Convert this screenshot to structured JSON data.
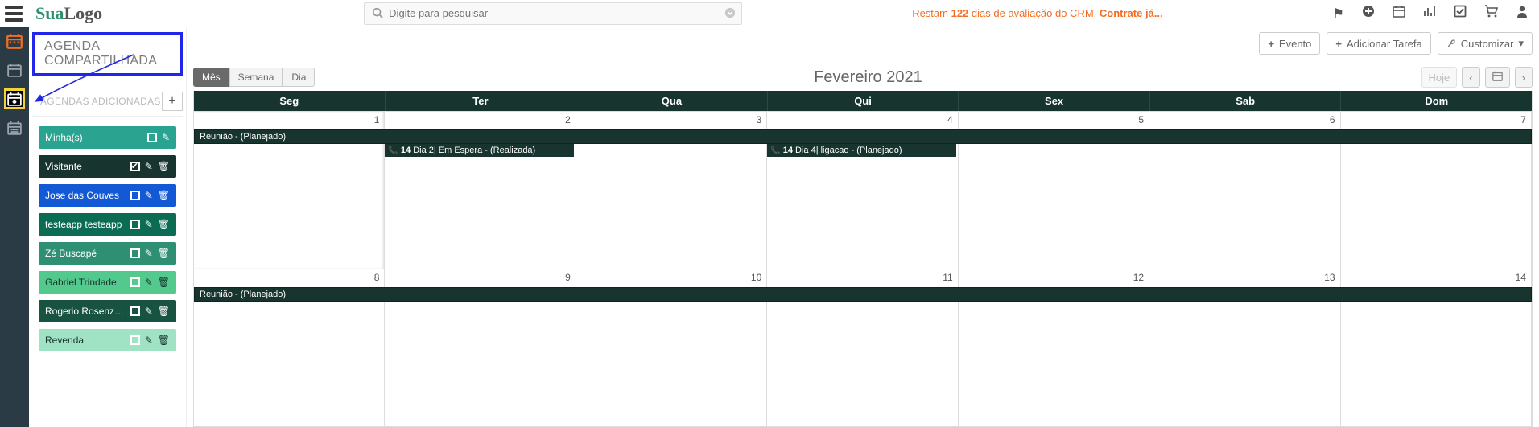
{
  "header": {
    "logo_part1": "Sua",
    "logo_part2": "Logo",
    "search_placeholder": "Digite para pesquisar",
    "trial_prefix": "Restam ",
    "trial_days": "122",
    "trial_mid": " dias de avaliação do CRM. ",
    "trial_link": "Contrate já..."
  },
  "sidebar": {
    "tab_title": "AGENDA COMPARTILHADA",
    "section_label": "AGENDAS ADICIONADAS",
    "items": [
      {
        "label": "Minha(s)",
        "color": "#2aa491",
        "checked": false,
        "can_delete": false
      },
      {
        "label": "Visitante",
        "color": "#17342e",
        "checked": true,
        "can_delete": true
      },
      {
        "label": "Jose das Couves",
        "color": "#1359d6",
        "checked": false,
        "can_delete": true
      },
      {
        "label": "testeapp testeapp",
        "color": "#0c6b53",
        "checked": false,
        "can_delete": true
      },
      {
        "label": "Zé Buscapé",
        "color": "#2f8f73",
        "checked": false,
        "can_delete": true
      },
      {
        "label": "Gabriel Trindade",
        "color": "#53c98d",
        "checked": false,
        "can_delete": true
      },
      {
        "label": "Rogerio Rosenzveig",
        "color": "#175340",
        "checked": false,
        "can_delete": true
      },
      {
        "label": "Revenda",
        "color": "#9fe2c4",
        "checked": false,
        "can_delete": true
      }
    ]
  },
  "toolbar": {
    "evento": "Evento",
    "add_tarefa": "Adicionar Tarefa",
    "customizar": "Customizar"
  },
  "calendar": {
    "views": {
      "month": "Mês",
      "week": "Semana",
      "day": "Dia"
    },
    "title": "Fevereiro 2021",
    "today": "Hoje",
    "dow": [
      "Seg",
      "Ter",
      "Qua",
      "Qui",
      "Sex",
      "Sab",
      "Dom"
    ],
    "week1_days": [
      "1",
      "2",
      "3",
      "4",
      "5",
      "6",
      "7"
    ],
    "week2_days": [
      "8",
      "9",
      "10",
      "11",
      "12",
      "13",
      "14"
    ],
    "all_week_event": "Reunião - (Planejado)",
    "ter_event_hour": "14",
    "ter_event_text": "Dia 2|  Em Espera - (Realizada)",
    "qui_event_hour": "14",
    "qui_event_text": "Dia 4|  ligacao - (Planejado)"
  }
}
